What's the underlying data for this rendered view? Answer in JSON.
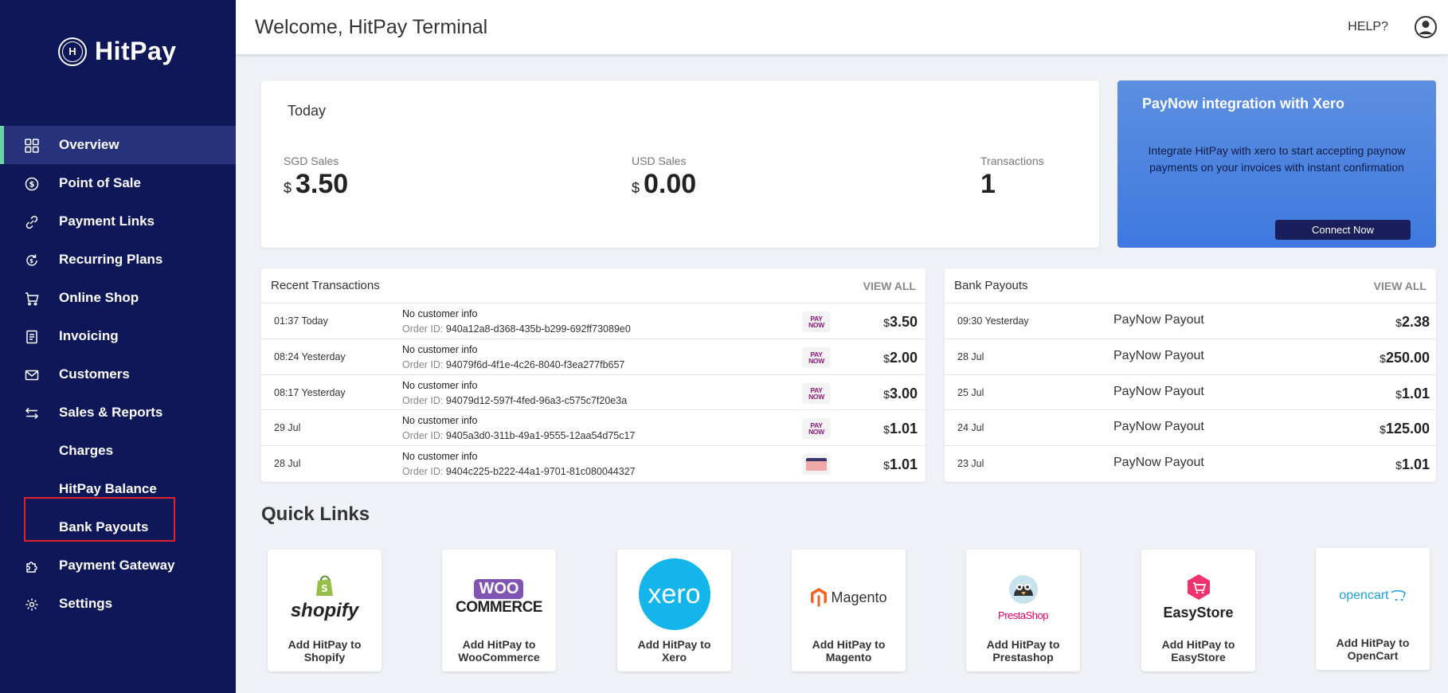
{
  "brand": {
    "name": "HitPay",
    "mark": "H"
  },
  "colors": {
    "sidebar": "#0e1758",
    "active_indicator": "#6bd3a6",
    "highlight": "#e0202a",
    "promo": "#4a82e0"
  },
  "sidebar": {
    "items": [
      {
        "label": "Overview",
        "icon": "grid-icon"
      },
      {
        "label": "Point of Sale",
        "icon": "dollar-circle-icon"
      },
      {
        "label": "Payment Links",
        "icon": "link-icon"
      },
      {
        "label": "Recurring Plans",
        "icon": "recurring-icon"
      },
      {
        "label": "Online Shop",
        "icon": "cart-icon"
      },
      {
        "label": "Invoicing",
        "icon": "document-icon"
      },
      {
        "label": "Customers",
        "icon": "mail-icon"
      },
      {
        "label": "Sales & Reports",
        "icon": "arrows-icon"
      },
      {
        "label": "Charges",
        "icon": ""
      },
      {
        "label": "HitPay Balance",
        "icon": ""
      },
      {
        "label": "Bank Payouts",
        "icon": ""
      },
      {
        "label": "Payment Gateway",
        "icon": "puzzle-icon"
      },
      {
        "label": "Settings",
        "icon": "gear-icon"
      }
    ]
  },
  "header": {
    "title": "Welcome, HitPay Terminal",
    "help": "HELP?"
  },
  "today": {
    "title": "Today",
    "sgd_label": "SGD Sales",
    "sgd_currency": "$",
    "sgd_value": "3.50",
    "usd_label": "USD Sales",
    "usd_currency": "$",
    "usd_value": "0.00",
    "tx_label": "Transactions",
    "tx_value": "1"
  },
  "promo": {
    "title": "PayNow integration with Xero",
    "description": "Integrate HitPay with xero to start accepting paynow payments on your invoices with instant confirmation",
    "button": "Connect Now"
  },
  "recent": {
    "title": "Recent Transactions",
    "view_all": "VIEW ALL",
    "order_prefix": "Order ID:",
    "rows": [
      {
        "time": "01:37 Today",
        "customer": "No customer info",
        "order_id": "940a12a8-d368-435b-b299-692ff73089e0",
        "method": "paynow",
        "currency": "$",
        "amount": "3.50"
      },
      {
        "time": "08:24 Yesterday",
        "customer": "No customer info",
        "order_id": "94079f6d-4f1e-4c26-8040-f3ea277fb657",
        "method": "paynow",
        "currency": "$",
        "amount": "2.00"
      },
      {
        "time": "08:17 Yesterday",
        "customer": "No customer info",
        "order_id": "94079d12-597f-4fed-96a3-c575c7f20e3a",
        "method": "paynow",
        "currency": "$",
        "amount": "3.00"
      },
      {
        "time": "29 Jul",
        "customer": "No customer info",
        "order_id": "9405a3d0-311b-49a1-9555-12aa54d75c17",
        "method": "paynow",
        "currency": "$",
        "amount": "1.01"
      },
      {
        "time": "28 Jul",
        "customer": "No customer info",
        "order_id": "9404c225-b222-44a1-9701-81c080044327",
        "method": "card",
        "currency": "$",
        "amount": "1.01"
      }
    ]
  },
  "paynow_logo": {
    "line1": "PAY",
    "line2": "NOW"
  },
  "payouts": {
    "title": "Bank Payouts",
    "view_all": "VIEW ALL",
    "rows": [
      {
        "time": "09:30 Yesterday",
        "name": "PayNow Payout",
        "currency": "$",
        "amount": "2.38"
      },
      {
        "time": "28 Jul",
        "name": "PayNow Payout",
        "currency": "$",
        "amount": "250.00"
      },
      {
        "time": "25 Jul",
        "name": "PayNow Payout",
        "currency": "$",
        "amount": "1.01"
      },
      {
        "time": "24 Jul",
        "name": "PayNow Payout",
        "currency": "$",
        "amount": "125.00"
      },
      {
        "time": "23 Jul",
        "name": "PayNow Payout",
        "currency": "$",
        "amount": "1.01"
      }
    ]
  },
  "quick_links": {
    "title": "Quick Links",
    "items": [
      {
        "logo_text": "shopify",
        "label_line1": "Add HitPay to",
        "label_line2": "Shopify",
        "logo": "shopify-logo"
      },
      {
        "logo_text": "WOO",
        "logo_text2": "COMMERCE",
        "label_line1": "Add HitPay to",
        "label_line2": "WooCommerce",
        "logo": "woocommerce-logo"
      },
      {
        "logo_text": "xero",
        "label_line1": "Add HitPay to",
        "label_line2": "Xero",
        "logo": "xero-logo"
      },
      {
        "logo_text": "Magento",
        "label_line1": "Add HitPay to",
        "label_line2": "Magento",
        "logo": "magento-logo"
      },
      {
        "logo_text": "PrestaShop",
        "label_line1": "Add HitPay to",
        "label_line2": "Prestashop",
        "logo": "prestashop-logo"
      },
      {
        "logo_text": "EasyStore",
        "label_line1": "Add HitPay to",
        "label_line2": "EasyStore",
        "logo": "easystore-logo"
      },
      {
        "logo_text": "opencart",
        "label_line1": "Add HitPay to",
        "label_line2": "OpenCart",
        "logo": "opencart-logo"
      }
    ]
  }
}
